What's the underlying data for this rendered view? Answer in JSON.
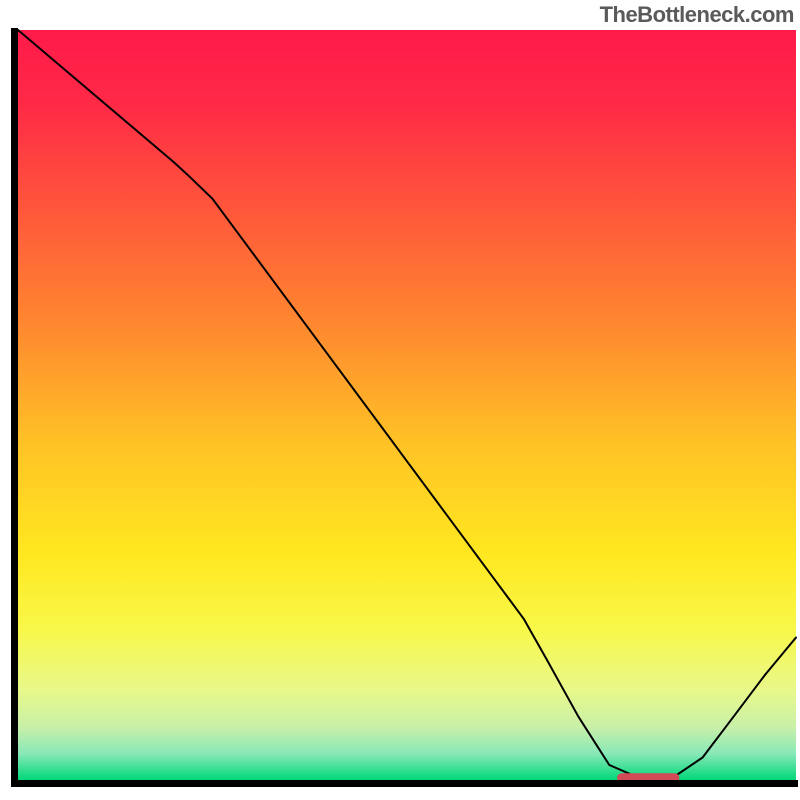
{
  "watermark": "TheBottleneck.com",
  "chart_data": {
    "type": "line",
    "title": "",
    "xlabel": "",
    "ylabel": "",
    "xlim": [
      0,
      100
    ],
    "ylim": [
      0,
      100
    ],
    "grid": false,
    "legend": false,
    "background_gradient": {
      "type": "vertical",
      "stops": [
        {
          "offset": 0.0,
          "color": "#ff1a4a"
        },
        {
          "offset": 0.1,
          "color": "#ff2a46"
        },
        {
          "offset": 0.25,
          "color": "#ff5a3a"
        },
        {
          "offset": 0.4,
          "color": "#ff8a2f"
        },
        {
          "offset": 0.55,
          "color": "#ffc226"
        },
        {
          "offset": 0.7,
          "color": "#ffe820"
        },
        {
          "offset": 0.8,
          "color": "#f8f84a"
        },
        {
          "offset": 0.88,
          "color": "#e8f88a"
        },
        {
          "offset": 0.93,
          "color": "#c8f0a8"
        },
        {
          "offset": 0.965,
          "color": "#88e8b8"
        },
        {
          "offset": 1.0,
          "color": "#00d878"
        }
      ]
    },
    "series": [
      {
        "name": "bottleneck-curve",
        "color": "#000000",
        "width": 2,
        "x": [
          0.0,
          5,
          10,
          15,
          20,
          22,
          25,
          30,
          35,
          40,
          45,
          50,
          55,
          60,
          65,
          68,
          72,
          76,
          80,
          84,
          88,
          92,
          96,
          100
        ],
        "y": [
          100,
          95.6,
          91.2,
          86.8,
          82.4,
          80.5,
          77.5,
          70.5,
          63.5,
          56.5,
          49.5,
          42.5,
          35.5,
          28.5,
          21.5,
          16.0,
          8.5,
          2.0,
          0.2,
          0.2,
          3.0,
          8.5,
          14.0,
          19.0
        ]
      }
    ],
    "marker": {
      "name": "optimal-range",
      "shape": "capsule",
      "color": "#d14a56",
      "x_start": 77,
      "x_end": 85,
      "y": 0.3,
      "height": 1.2
    },
    "axes": {
      "frame_color": "#000000",
      "frame_width": 7,
      "ticks": false,
      "tick_labels": false
    }
  }
}
